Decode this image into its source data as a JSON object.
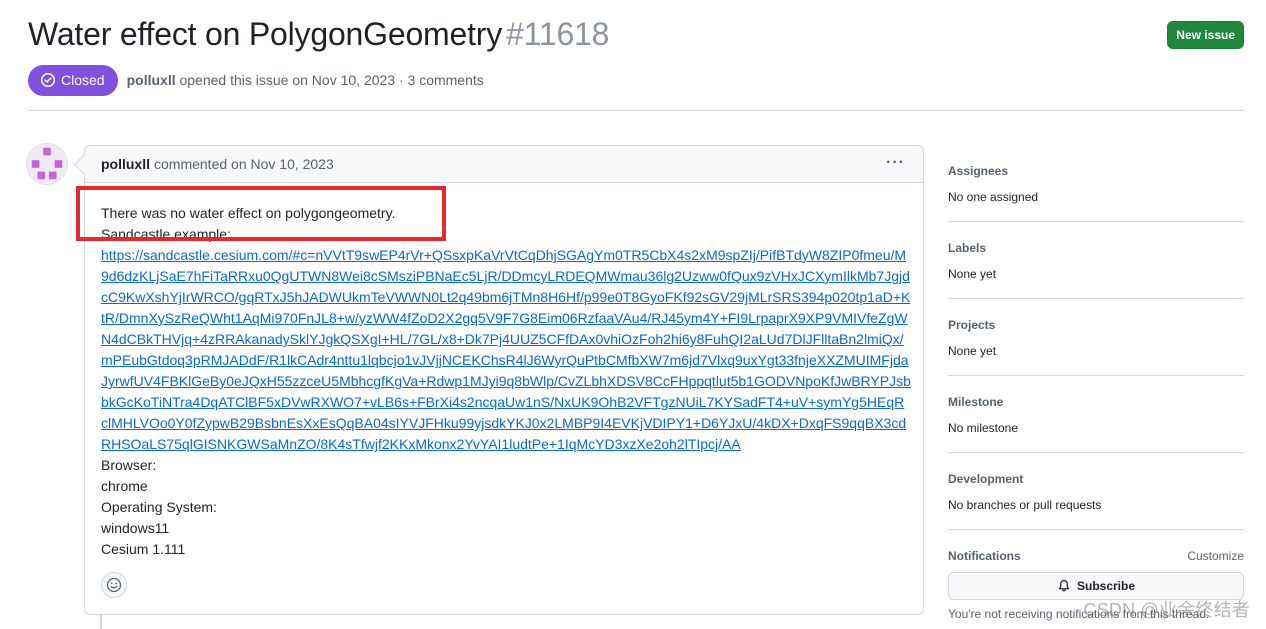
{
  "issue": {
    "title": "Water effect on PolygonGeometry",
    "number": "#11618",
    "new_issue_label": "New issue",
    "state": "Closed",
    "author": "polluxll",
    "opened_text": "opened this issue on Nov 10, 2023 · 3 comments"
  },
  "comment": {
    "author": "polluxll",
    "meta": "commented on Nov 10, 2023",
    "menu_icon": "kebab-horizontal-icon",
    "lines": [
      "There was no water effect on polygongeometry.",
      "Sandcastle example:"
    ],
    "link": "https://sandcastle.cesium.com/#c=nVVtT9swEP4rVr+QSsxpKaVrVtCqDhjSGAgYm0TR5CbX4s2xM9spZIj/PifBTdyW8ZIP0fmeu/M9d6dzKLjSaE7hFiTaRRxu0QgUTWN8Wei8cSMsziPBNaEc5LjR/DDmcyLRDEQMWmau36lg2Uzww0fQux9zVHxJCXymIlkMb7JgjdcC9KwXshYjIrWRCO/gqRTxJ5hJADWUkmTeVWWN0Lt2q49bm6jTMn8H6Hf/p99e0T8GyoFKf92sGV29jMLrSRS394p020tp1aD+KtR/DmnXySzReQWht1AqMi970FnJL8+w/yzWW4fZoD2X2gq5V9F7G8Eim06RzfaaVAu4/RJ45ym4Y+FI9LrpaprX9XP9VMIVfeZgWN4dCBkTHVjq+4zRRAkanadySklYJgkQSXgI+HL/7GL/x8+Dk7Pj4UUZ5CFfDAx0vhiOzFoh2hi6y8FuhQI2aLUd7DlJFlltaBn2lmiQx/mPEubGtdoq3pRMJADdF/R1lkCAdr4nttu1lqbcjo1vJVjjNCEKChsR4lJ6WyrQuPtbCMfbXW7m6jd7Vlxq9uxYgt33fnjeXXZMUIMFjdaJyrwfUV4FBKlGeBy0eJQxH55zzceU5MbhcgfKgVa+Rdwp1MJyi9q8bWlp/CvZLbhXDSV8CcFHppqtlut5b1GODVNpoKfJwBRYPJsbbkGcKoTiNTra4DqATClBF5xDVwRXWO7+vLB6s+FBrXi4s2ncqaUw1nS/NxUK9OhB2VFTgzNUiL7KYSadFT4+uV+symYg5HEqRclMHLVOo0Y0fZypwB29BsbnEsXxEsQqBA04sIYVJFHku99yjsdkYKJ0x2LMBP9I4EVKjVDIPY1+D6YJxU/4kDX+DxqFS9qqBX3cdRHSOaLS75qlGISNKGWSaMnZO/8K4sTfwjf2KKxMkonx2YvYAI1ludtPe+1IqMcYD3xzXe2oh2lTIpcj/AA",
    "extra_lines": [
      "Browser:",
      "chrome",
      "Operating System:",
      "windows11",
      "Cesium 1.111"
    ],
    "emoji_icon": "smiley-icon"
  },
  "sidebar": {
    "sections": [
      {
        "heading": "Assignees",
        "value": "No one assigned"
      },
      {
        "heading": "Labels",
        "value": "None yet"
      },
      {
        "heading": "Projects",
        "value": "None yet"
      },
      {
        "heading": "Milestone",
        "value": "No milestone"
      },
      {
        "heading": "Development",
        "value": "No branches or pull requests"
      }
    ],
    "notifications": {
      "heading": "Notifications",
      "customize": "Customize",
      "subscribe_label": "Subscribe",
      "note": "You're not receiving notifications from this thread."
    }
  },
  "watermark": "CSDN @业余终结者",
  "colors": {
    "closed_badge": "#8250df",
    "new_issue_button": "#1f883d",
    "link": "#0969da",
    "highlight": "#e8282e"
  }
}
